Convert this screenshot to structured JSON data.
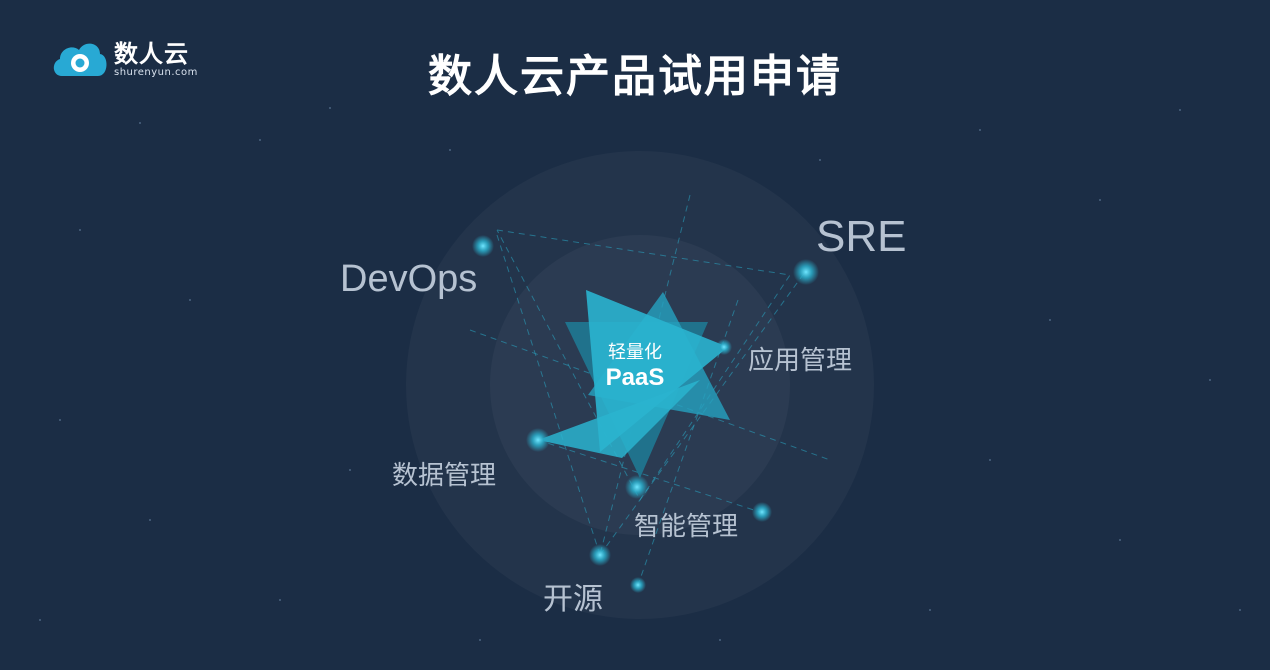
{
  "brand": {
    "name": "数人云",
    "domain": "shurenyun.com"
  },
  "page": {
    "title": "数人云产品试用申请"
  },
  "diagram": {
    "center_line1": "轻量化",
    "center_line2": "PaaS",
    "nodes": {
      "sre": "SRE",
      "devops": "DevOps",
      "app_mgmt": "应用管理",
      "data_mgmt": "数据管理",
      "smart_mgmt": "智能管理",
      "open_source": "开源"
    }
  },
  "colors": {
    "background": "#1b2d45",
    "accent": "#29a9c6",
    "label": "#b6c2d1"
  },
  "icons": [
    "cloud-logo-icon"
  ]
}
